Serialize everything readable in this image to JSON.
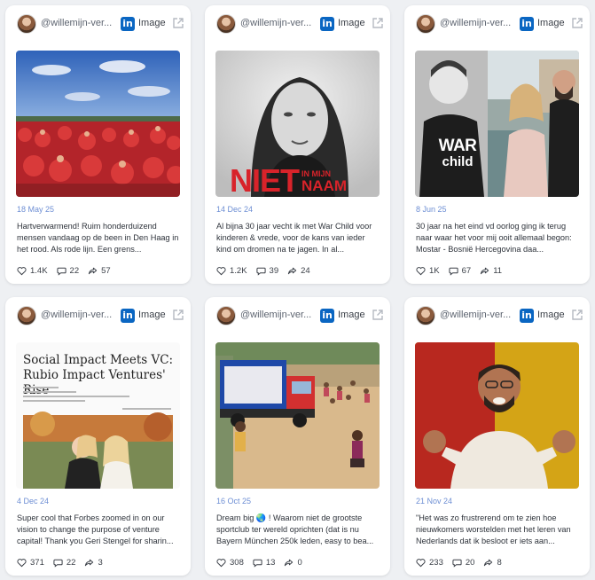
{
  "posts": [
    {
      "handle": "@willemijn-ver...",
      "type": "Image",
      "date": "18 May 25",
      "excerpt": "Hartverwarmend! Ruim honderduizend mensen vandaag op de been in Den Haag in het rood. Als rode lijn. Een grens...",
      "likes": "1.4K",
      "comments": "22",
      "shares": "57",
      "image_icon": "crowd-in-red-photo"
    },
    {
      "handle": "@willemijn-ver...",
      "type": "Image",
      "date": "14 Dec 24",
      "excerpt": "Al bijna 30 jaar vecht ik met War Child voor kinderen & vrede, voor de kans van ieder kind om dromen na te jagen. In al...",
      "likes": "1.2K",
      "comments": "39",
      "shares": "24",
      "overlay_big": "NIET",
      "overlay_small_1": "IN MIJN",
      "overlay_small_2": "NAAM"
    },
    {
      "handle": "@willemijn-ver...",
      "type": "Image",
      "date": "8 Jun 25",
      "excerpt": "30 jaar na het eind vd oorlog ging ik terug naar waar het voor mij ooit allemaal begon: Mostar - Bosnië Hercegovina daa...",
      "likes": "1K",
      "comments": "67",
      "shares": "11",
      "shirt_line_1": "WAR",
      "shirt_line_2": "child"
    },
    {
      "handle": "@willemijn-ver...",
      "type": "Image",
      "date": "4 Dec 24",
      "excerpt": "Super cool that Forbes zoomed in on our vision to change the purpose of venture capital! Thank you Geri Stengel for sharin...",
      "likes": "371",
      "comments": "22",
      "shares": "3",
      "article_title": "Social Impact Meets VC: Rubio Impact Ventures' Rise"
    },
    {
      "handle": "@willemijn-ver...",
      "type": "Image",
      "date": "16 Oct 25",
      "excerpt": "Dream big 🌏 ! Waarom niet de grootste sportclub ter wereld oprichten (dat is nu Bayern München 250k leden, easy to bea...",
      "likes": "308",
      "comments": "13",
      "shares": "0"
    },
    {
      "handle": "@willemijn-ver...",
      "type": "Image",
      "date": "21 Nov 24",
      "excerpt": "\"Het was zo frustrerend om te zien hoe nieuwkomers worstelden met het leren van Nederlands dat ik besloot er iets aan...",
      "likes": "233",
      "comments": "20",
      "shares": "8"
    }
  ],
  "colors": {
    "accent_date": "#6e8fd4",
    "linkedin": "#0a66c2",
    "page_bg": "#eef0f3"
  }
}
